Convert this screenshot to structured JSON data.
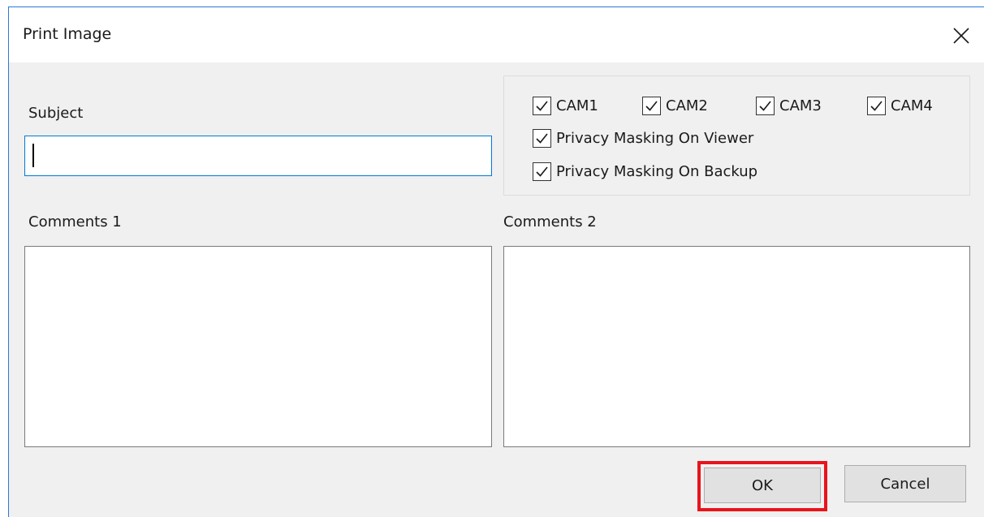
{
  "dialog": {
    "title": "Print Image"
  },
  "subject": {
    "label": "Subject",
    "value": ""
  },
  "options": {
    "cameras": [
      {
        "label": "CAM1",
        "checked": true
      },
      {
        "label": "CAM2",
        "checked": true
      },
      {
        "label": "CAM3",
        "checked": true
      },
      {
        "label": "CAM4",
        "checked": true
      }
    ],
    "privacy_viewer": {
      "label": "Privacy Masking On Viewer",
      "checked": true
    },
    "privacy_backup": {
      "label": "Privacy Masking On Backup",
      "checked": true
    }
  },
  "comments1": {
    "label": "Comments 1",
    "value": ""
  },
  "comments2": {
    "label": "Comments 2",
    "value": ""
  },
  "buttons": {
    "ok_label": "OK",
    "cancel_label": "Cancel"
  },
  "colors": {
    "focus_border": "#0078d7",
    "highlight": "#e8141c",
    "dialog_bg": "#f0f0f0"
  },
  "icons": {
    "close": "close-icon",
    "check": "checkmark-icon"
  }
}
